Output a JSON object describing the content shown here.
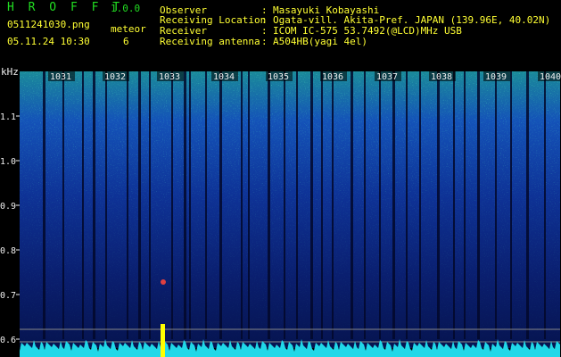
{
  "header": {
    "brand": "H R O F F T",
    "version": "1.0.0",
    "filename": "0511241030.png",
    "meteor_label": "meteor",
    "datetime": "05.11.24 10:30",
    "meteor_count": "6",
    "info": [
      {
        "key": "Observer",
        "value": "Masayuki Kobayashi"
      },
      {
        "key": "Receiving Location",
        "value": "Ogata-vill. Akita-Pref. JAPAN (139.96E, 40.02N)"
      },
      {
        "key": "Receiver",
        "value": "ICOM IC-575 53.7492(@LCD)MHz USB"
      },
      {
        "key": "Receiving antenna",
        "value": "A504HB(yagi 4el)"
      }
    ],
    "colon": ":"
  },
  "spectrogram": {
    "y_unit": "kHz",
    "y_ticks": [
      "1.1",
      "1.0",
      "0.9",
      "0.8",
      "0.7",
      "0.6"
    ],
    "x_ticks": [
      "1031",
      "1032",
      "1033",
      "1034",
      "1035",
      "1036",
      "1037",
      "1038",
      "1039",
      "1040"
    ],
    "colors": {
      "low": "#0a1a6a",
      "mid": "#1e6fd0",
      "high": "#20d080",
      "peak": "#d8e040",
      "trace": "#20d8e8",
      "spike": "#ffff00"
    }
  }
}
